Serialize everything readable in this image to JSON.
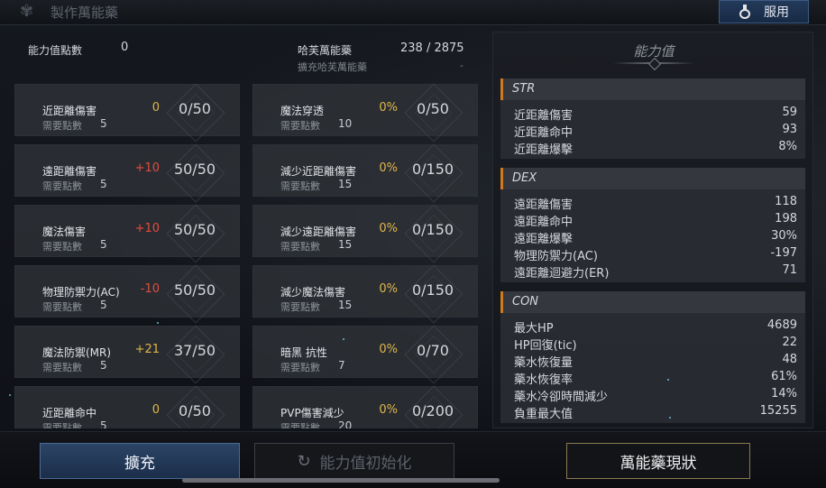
{
  "window": {
    "title": "製作萬能藥",
    "use_button": "服用"
  },
  "header": {
    "points_label": "能力值點數",
    "points_value": "0",
    "elixir_label": "哈芙萬能藥",
    "elixir_value": "238 / 2875",
    "expand_label": "擴充哈芙萬能藥",
    "expand_value": "-"
  },
  "req_label": "需要點數",
  "cards": [
    {
      "name": "近距離傷害",
      "req": "5",
      "bonus": "0",
      "level": "0/50",
      "tone": "zero"
    },
    {
      "name": "魔法穿透",
      "req": "10",
      "bonus": "0%",
      "level": "0/50",
      "tone": "gold"
    },
    {
      "name": "遠距離傷害",
      "req": "5",
      "bonus": "+10",
      "level": "50/50",
      "tone": "red"
    },
    {
      "name": "減少近距離傷害",
      "req": "15",
      "bonus": "0%",
      "level": "0/150",
      "tone": "gold"
    },
    {
      "name": "魔法傷害",
      "req": "5",
      "bonus": "+10",
      "level": "50/50",
      "tone": "red"
    },
    {
      "name": "減少遠距離傷害",
      "req": "15",
      "bonus": "0%",
      "level": "0/150",
      "tone": "gold"
    },
    {
      "name": "物理防禦力(AC)",
      "req": "5",
      "bonus": "-10",
      "level": "50/50",
      "tone": "red"
    },
    {
      "name": "減少魔法傷害",
      "req": "15",
      "bonus": "0%",
      "level": "0/150",
      "tone": "gold"
    },
    {
      "name": "魔法防禦(MR)",
      "req": "5",
      "bonus": "+21",
      "level": "37/50",
      "tone": "gold"
    },
    {
      "name": "暗黑 抗性",
      "req": "7",
      "bonus": "0%",
      "level": "0/70",
      "tone": "gold"
    },
    {
      "name": "近距離命中",
      "req": "5",
      "bonus": "0",
      "level": "0/50",
      "tone": "zero"
    },
    {
      "name": "PVP傷害減少",
      "req": "20",
      "bonus": "0%",
      "level": "0/200",
      "tone": "gold"
    }
  ],
  "stats": {
    "title": "能力值",
    "groups": [
      {
        "name": "STR",
        "rows": [
          {
            "label": "近距離傷害",
            "value": "59"
          },
          {
            "label": "近距離命中",
            "value": "93"
          },
          {
            "label": "近距離爆擊",
            "value": "8%"
          }
        ]
      },
      {
        "name": "DEX",
        "rows": [
          {
            "label": "遠距離傷害",
            "value": "118"
          },
          {
            "label": "遠距離命中",
            "value": "198"
          },
          {
            "label": "遠距離爆擊",
            "value": "30%"
          },
          {
            "label": "物理防禦力(AC)",
            "value": "-197"
          },
          {
            "label": "遠距離迴避力(ER)",
            "value": "71"
          }
        ]
      },
      {
        "name": "CON",
        "rows": [
          {
            "label": "最大HP",
            "value": "4689"
          },
          {
            "label": "HP回復(tic)",
            "value": "22"
          },
          {
            "label": "藥水恢復量",
            "value": "48"
          },
          {
            "label": "藥水恢復率",
            "value": "61%"
          },
          {
            "label": "藥水冷卻時間減少",
            "value": "14%"
          },
          {
            "label": "負重最大值",
            "value": "15255"
          }
        ]
      }
    ]
  },
  "buttons": {
    "expand": "擴充",
    "reset": "能力值初始化",
    "status": "萬能藥現狀"
  },
  "colors": {
    "bonus_gold": "#e0b64a",
    "bonus_red": "#e24c40",
    "section_accent": "#d07a1f",
    "primary_button": "#2c4466"
  },
  "icons": {
    "title": "crest-icon",
    "use": "potion-icon",
    "reset": "reset-icon"
  }
}
